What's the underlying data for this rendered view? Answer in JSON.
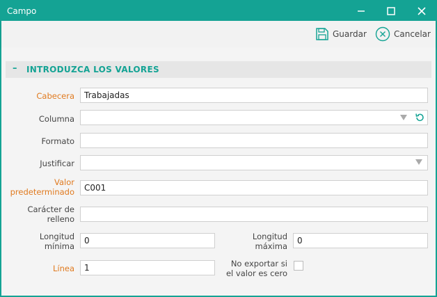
{
  "window": {
    "title": "Campo",
    "accent": "#14a394"
  },
  "toolbar": {
    "save_label": "Guardar",
    "cancel_label": "Cancelar"
  },
  "section": {
    "toggle": "–",
    "title": "INTRODUZCA LOS VALORES"
  },
  "form": {
    "cabecera": {
      "label": "Cabecera",
      "value": "Trabajadas"
    },
    "columna": {
      "label": "Columna",
      "value": ""
    },
    "formato": {
      "label": "Formato",
      "value": ""
    },
    "justificar": {
      "label": "Justificar",
      "value": ""
    },
    "valor_predeterminado": {
      "label_line1": "Valor",
      "label_line2": "predeterminado",
      "value": "C001"
    },
    "caracter_relleno": {
      "label_line1": "Carácter de",
      "label_line2": "relleno",
      "value": ""
    },
    "longitud_minima": {
      "label_line1": "Longitud",
      "label_line2": "mínima",
      "value": "0"
    },
    "longitud_maxima": {
      "label_line1": "Longitud",
      "label_line2": "máxima",
      "value": "0"
    },
    "linea": {
      "label": "Línea",
      "value": "1"
    },
    "no_exportar": {
      "label_line1": "No exportar si",
      "label_line2": "el valor es cero",
      "checked": false
    }
  }
}
